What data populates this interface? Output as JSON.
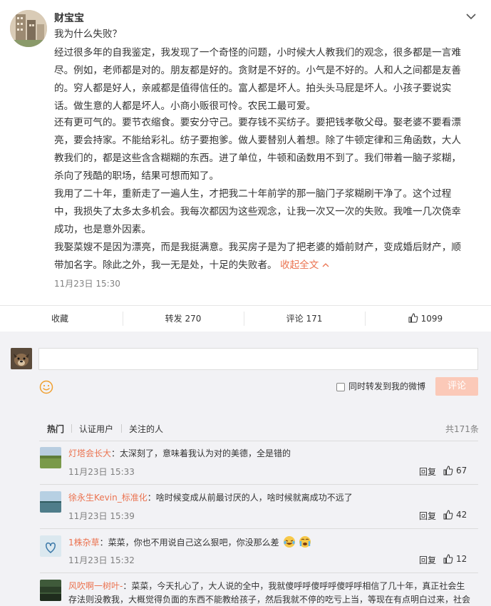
{
  "post": {
    "author": "财宝宝",
    "title": "我为什么失败？",
    "lines": [
      "经过很多年的自我鉴定，我发现了一个奇怪的问题，小时候大人教我们的观念，很多都是一言难",
      "尽。例如，老师都是对的。朋友都是好的。贪财是不好的。小气是不好的。人和人之间都是友善",
      "的。穷人都是好人，亲戚都是值得信任的。富人都是坏人。拍头头马屁是坏人。小孩子要说实",
      "话。做生意的人都是坏人。小商小贩很可怜。农民工最可爱。",
      "还有更可气的。要节衣缩食。要安分守己。要存钱不买纺子。要把钱孝敬父母。娶老婆不要看漂",
      "亮，要会持家。不能给彩礼。纺子要抱爹。做人要替别人着想。除了牛顿定律和三角函数，大人",
      "教我们的，都是这些含含糊糊的东西。进了单位，牛顿和函数用不到了。我们带着一脑子浆糊，",
      "杀向了残酷的职场，结果可想而知了。",
      "我用了二十年，重新走了一遍人生，才把我二十年前学的那一脑门子浆糊刷干净了。这个过程",
      "中，我损失了太多太多机会。我每次都因为这些观念，让我一次又一次的失败。我唯一几次侥幸",
      "成功，也是意外因素。",
      "我娶菜嫂不是因为漂亮，而是我挺满意。我买房子是为了把老婆的婚前财产，变成婚后财产，顺",
      "带加名字。除此之外，我一无是处，十足的失败者。"
    ],
    "collapse_label": "收起全文",
    "time": "11月23日 15:30"
  },
  "actions": {
    "favorite": "收藏",
    "repost": "转发 270",
    "comment": "评论 171",
    "like": "1099"
  },
  "composer": {
    "sync_label": "同时转发到我的微博",
    "submit": "评论"
  },
  "tabs": [
    "热门",
    "认证用户",
    "关注的人"
  ],
  "total": "共171条",
  "comments": [
    {
      "name": "灯塔会长大",
      "text": "：太深刻了，意味着我认为对的美德，全是错的",
      "time": "11月23日 15:33",
      "reply": "回复",
      "likes": "67"
    },
    {
      "name": "徐永生Kevin_标准化",
      "text": "：啥时候变成从前最讨厌的人，啥时候就离成功不远了",
      "time": "11月23日 15:39",
      "reply": "回复",
      "likes": "42"
    },
    {
      "name": "1株杂草",
      "text": "：菜菜，你也不用说自己这么狠吧，你没那么差",
      "time": "11月23日 15:32",
      "reply": "回复",
      "likes": "12"
    },
    {
      "name": "风吹啊一树叶-",
      "text": "：菜菜，今天扎心了，大人说的全中，我就傻呼呼傻呼呼傻呼呼相信了几十年，真正社会生",
      "text2": "存法则没教我，大概觉得负面的东西不能教给孩子，然后我就不停的吃亏上当，等现在有点明白过来，社会"
    }
  ],
  "colors": {
    "accent": "#eb7350",
    "link": "#5d7ea7"
  }
}
